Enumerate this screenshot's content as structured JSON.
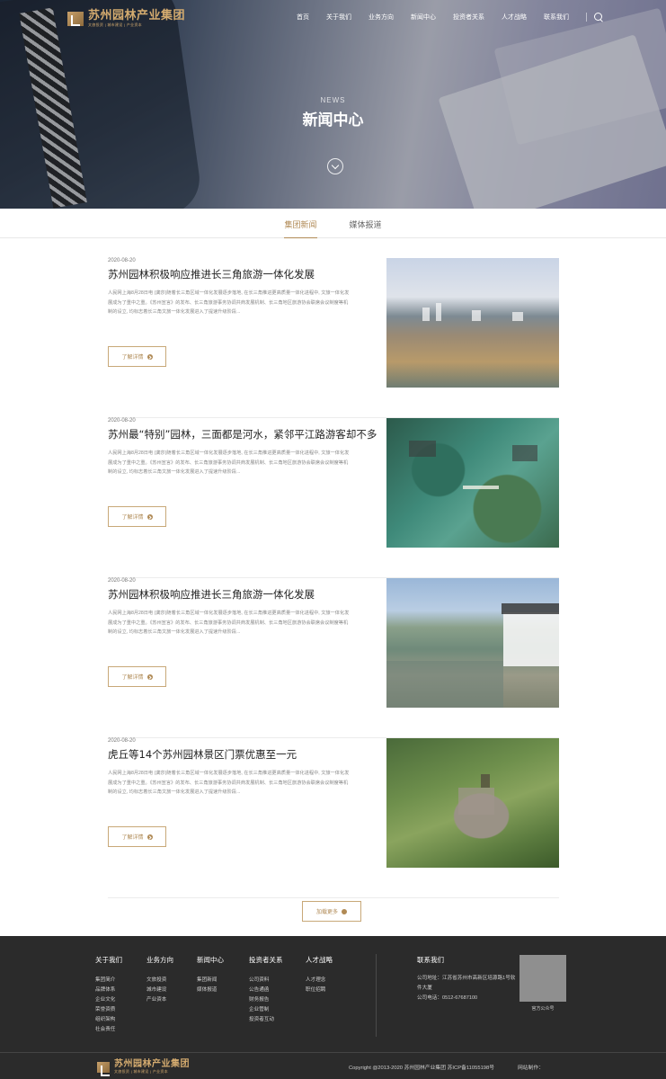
{
  "brand": {
    "name": "苏州园林产业集团",
    "tagline": "文旅投资 | 城市建设 | 产业资本"
  },
  "nav": {
    "items": [
      "首页",
      "关于我们",
      "业务方向",
      "新闻中心",
      "投资者关系",
      "人才战略",
      "联系我们"
    ]
  },
  "hero": {
    "en": "NEWS",
    "title": "新闻中心"
  },
  "tabs": [
    {
      "label": "集团新闻",
      "active": true
    },
    {
      "label": "媒体报道",
      "active": false
    }
  ],
  "news": [
    {
      "date": "2020-08-20",
      "title": "苏州园林积极响应推进长三角旅游一体化发展",
      "desc": "人民网上海8月28日电 (龚莎)随着长三角区域一体化发展逐步落地, 在长三角推进更高质量一体化进程中, 文旅一体化发展成为了重中之重。《苏州宣言》的发布、长三角旅游事务协调共商发展机制、长三角地区旅游协会联席会议制度等机制的设立, 均标志着长三角文旅一体化发展进入了提速升级阶段...",
      "button": "了解详情"
    },
    {
      "date": "2020-08-20",
      "title": "苏州最“特别”园林，三面都是河水，紧邻平江路游客却不多",
      "desc": "人民网上海8月28日电 (龚莎)随着长三角区域一体化发展逐步落地, 在长三角推进更高质量一体化进程中, 文旅一体化发展成为了重中之重。《苏州宣言》的发布、长三角旅游事务协调共商发展机制、长三角地区旅游协会联席会议制度等机制的设立, 均标志着长三角文旅一体化发展进入了提速升级阶段...",
      "button": "了解详情"
    },
    {
      "date": "2020-08-20",
      "title": "苏州园林积极响应推进长三角旅游一体化发展",
      "desc": "人民网上海8月28日电 (龚莎)随着长三角区域一体化发展逐步落地, 在长三角推进更高质量一体化进程中, 文旅一体化发展成为了重中之重。《苏州宣言》的发布、长三角旅游事务协调共商发展机制、长三角地区旅游协会联席会议制度等机制的设立, 均标志着长三角文旅一体化发展进入了提速升级阶段...",
      "button": "了解详情"
    },
    {
      "date": "2020-08-20",
      "title": "虎丘等14个苏州园林景区门票优惠至一元",
      "desc": "人民网上海8月28日电 (龚莎)随着长三角区域一体化发展逐步落地, 在长三角推进更高质量一体化进程中, 文旅一体化发展成为了重中之重。《苏州宣言》的发布、长三角旅游事务协调共商发展机制、长三角地区旅游协会联席会议制度等机制的设立, 均标志着长三角文旅一体化发展进入了提速升级阶段...",
      "button": "了解详情"
    }
  ],
  "load_more": "加载更多",
  "footer": {
    "columns": [
      {
        "title": "关于我们",
        "items": [
          "集团简介",
          "品牌体系",
          "企业文化",
          "荣誉资质",
          "组织架构",
          "社会责任"
        ]
      },
      {
        "title": "业务方向",
        "items": [
          "文旅投资",
          "城市建设",
          "产业资本"
        ]
      },
      {
        "title": "新闻中心",
        "items": [
          "集团新闻",
          "媒体报道"
        ]
      },
      {
        "title": "投资者关系",
        "items": [
          "公司资料",
          "公告通函",
          "财务报告",
          "企业管制",
          "投资者互动"
        ]
      },
      {
        "title": "人才战略",
        "items": [
          "人才理念",
          "职位招聘"
        ]
      }
    ],
    "contact": {
      "title": "联系我们",
      "address": "公司地址：江苏省苏州市高新区培源路1号软件大厦",
      "phone": "公司电话：0512-67687100"
    },
    "qr_label": "官方公众号",
    "copyright": "Copyright @2013-2020 苏州园林产业集团  苏ICP备11055198号",
    "maker": "网站制作："
  }
}
